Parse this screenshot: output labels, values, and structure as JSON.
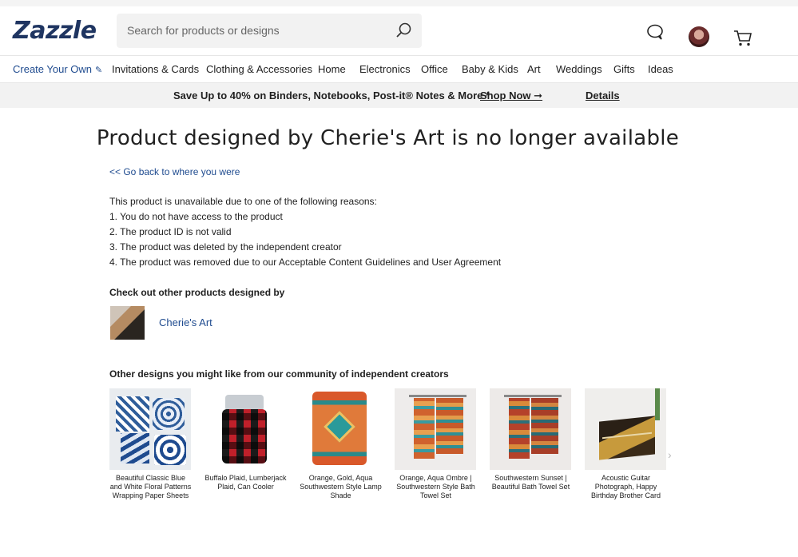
{
  "logo": "Zazzle",
  "search": {
    "placeholder": "Search for products or designs"
  },
  "nav": [
    "Create Your Own",
    "Invitations & Cards",
    "Clothing & Accessories",
    "Home",
    "Electronics",
    "Office",
    "Baby & Kids",
    "Art",
    "Weddings",
    "Gifts",
    "Ideas"
  ],
  "promo": {
    "text": "Save Up to 40% on Binders, Notebooks, Post-it® Notes & More *",
    "shop_now": "Shop Now ➞",
    "details": "Details"
  },
  "page": {
    "title": "Product designed by Cherie's Art is no longer available",
    "go_back": "<< Go back to where you were",
    "reasons": [
      "This product is unavailable due to one of the following reasons:",
      "1. You do not have access to the product",
      "2. The product ID is not valid",
      "3. The product was deleted by the independent creator",
      "4. The product was removed due to our Acceptable Content Guidelines and User Agreement"
    ],
    "checkout_heading": "Check out other products designed by",
    "creator_name": "Cherie's Art",
    "other_designs_heading": "Other designs you might like from our community of independent creators"
  },
  "products": [
    {
      "caption": "Beautiful Classic Blue and White Floral Patterns Wrapping Paper Sheets"
    },
    {
      "caption": "Buffalo Plaid, Lumberjack Plaid, Can Cooler"
    },
    {
      "caption": "Orange, Gold, Aqua Southwestern Style Lamp Shade"
    },
    {
      "caption": "Orange, Aqua Ombre | Southwestern Style Bath Towel Set"
    },
    {
      "caption": "Southwestern Sunset | Beautiful Bath Towel Set"
    },
    {
      "caption": "Acoustic Guitar Photograph, Happy Birthday Brother Card"
    }
  ],
  "colors": {
    "brand": "#1f3561",
    "link": "#1f4b8f",
    "promo_bg": "#f2f2f2"
  }
}
